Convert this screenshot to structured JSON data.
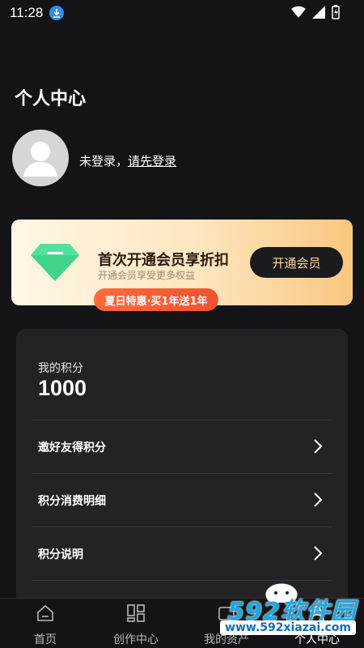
{
  "status_bar": {
    "time": "11:28"
  },
  "header": {
    "title": "个人中心"
  },
  "profile": {
    "status_text": "未登录，",
    "login_link": "请先登录"
  },
  "vip": {
    "title": "首次开通会员享折扣",
    "subtitle": "开通会员享受更多权益",
    "button_label": "开通会员",
    "promo": "夏日特惠·买1年送1年"
  },
  "points": {
    "label": "我的积分",
    "value": "1000",
    "menu": [
      {
        "label": "邀好友得积分"
      },
      {
        "label": "积分消费明细"
      },
      {
        "label": "积分说明"
      }
    ]
  },
  "tabbar": {
    "tabs": [
      {
        "label": "首页"
      },
      {
        "label": "创作中心"
      },
      {
        "label": "我的资产"
      },
      {
        "label": "个人中心"
      }
    ]
  },
  "watermark": {
    "brand": "592软件园",
    "url": "www.592xiazai.com"
  },
  "colors": {
    "accent_gold": "#f6d59a",
    "promo_orange": "#f0542f",
    "gem_green": "#3fd48a"
  }
}
